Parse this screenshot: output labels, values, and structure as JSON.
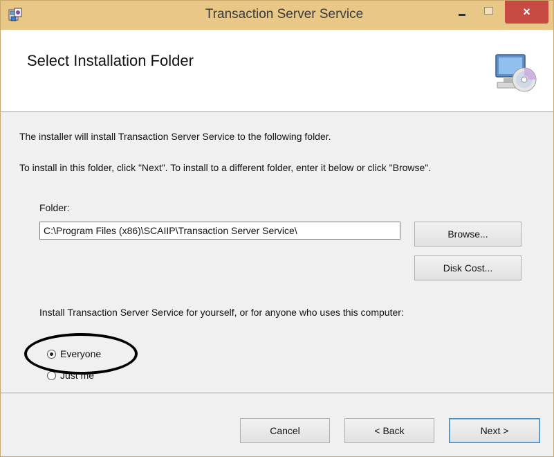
{
  "window": {
    "title": "Transaction Server Service",
    "close_glyph": "×"
  },
  "header": {
    "title": "Select Installation Folder",
    "icon": "computer-disc-icon"
  },
  "content": {
    "intro_line1": "The installer will install Transaction Server Service to the following folder.",
    "intro_line2": "To install in this folder, click \"Next\". To install to a different folder, enter it below or click \"Browse\".",
    "folder_label": "Folder:",
    "folder_value": "C:\\Program Files (x86)\\SCAIIP\\Transaction Server Service\\",
    "browse_label": "Browse...",
    "disk_cost_label": "Disk Cost...",
    "install_for_label": "Install Transaction Server Service for yourself, or for anyone who uses this computer:",
    "radio_options": [
      {
        "label": "Everyone",
        "selected": true
      },
      {
        "label": "Just me",
        "selected": false
      }
    ]
  },
  "footer": {
    "cancel_label": "Cancel",
    "back_label": "< Back",
    "next_label": "Next >"
  },
  "colors": {
    "titlebar": "#e8c787",
    "close_button": "#c74b43",
    "next_border": "#3c7fb1"
  }
}
